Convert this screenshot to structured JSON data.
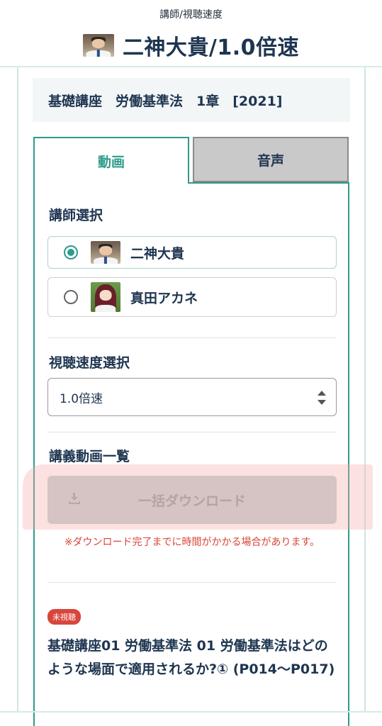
{
  "header": {
    "subtitle": "講師/視聴速度",
    "title": "二神大貴/1.0倍速",
    "avatar": "teacher-avatar"
  },
  "course": {
    "label": "基礎講座　労働基準法　1章　[2021]"
  },
  "tabs": [
    {
      "label": "動画",
      "active": true
    },
    {
      "label": "音声",
      "active": false
    }
  ],
  "instructor_section": {
    "heading": "講師選択",
    "options": [
      {
        "name": "二神大貴",
        "selected": true,
        "avatar": "teacher-avatar"
      },
      {
        "name": "真田アカネ",
        "selected": false,
        "avatar": "anime-girl-avatar"
      }
    ]
  },
  "speed_section": {
    "heading": "視聴速度選択",
    "selected_value": "1.0倍速"
  },
  "lecture_section": {
    "heading": "講義動画一覧",
    "download_button_label": "一括ダウンロード",
    "download_note": "※ダウンロード完了までに時間がかかる場合があります。"
  },
  "lectures": [
    {
      "badge": "未視聴",
      "title": "基礎講座01 労働基準法 01 労働基準法はどのような場面で適用されるか?① (P014～P017)"
    }
  ],
  "colors": {
    "accent": "#2e9b8a",
    "title": "#1e3550",
    "alert": "#d9453a",
    "tab_inactive": "#c9c9c9"
  }
}
